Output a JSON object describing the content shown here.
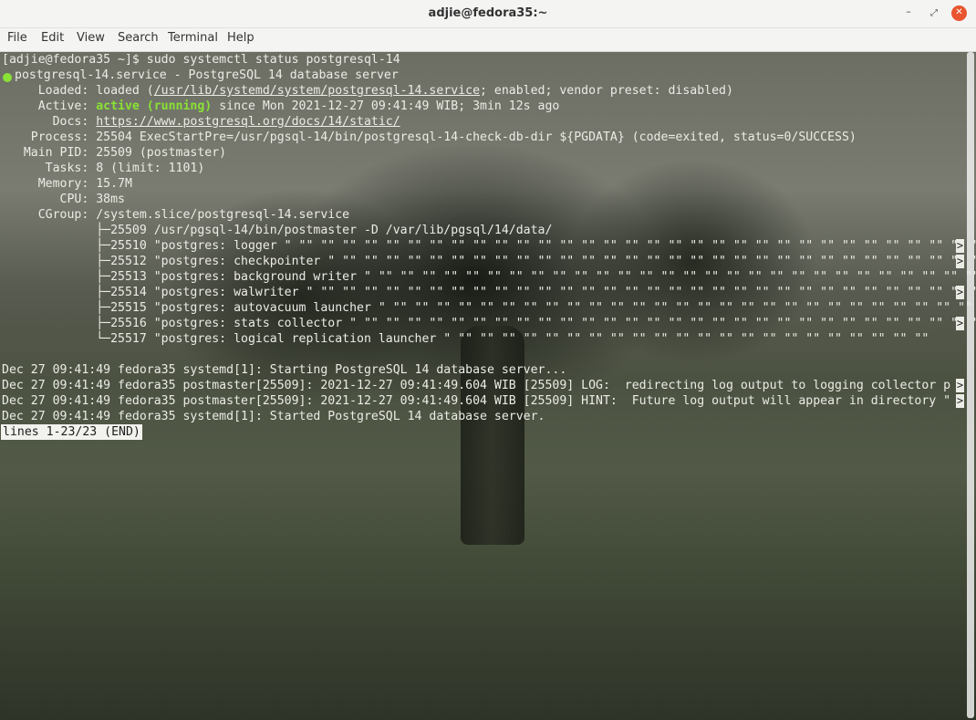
{
  "window": {
    "title": "adjie@fedora35:~",
    "min_glyph": "–",
    "max_glyph": "⤢",
    "close_glyph": "✕"
  },
  "menu": {
    "file": "File",
    "edit": "Edit",
    "view": "View",
    "search": "Search",
    "terminal": "Terminal",
    "help": "Help"
  },
  "terminal": {
    "prompt": "[adjie@fedora35 ~]$ sudo systemctl status postgresql-14",
    "unit_line": "postgresql-14.service - PostgreSQL 14 database server",
    "loaded_prefix": "     Loaded: loaded (",
    "loaded_path": "/usr/lib/systemd/system/postgresql-14.service",
    "loaded_suffix": "; enabled; vendor preset: disabled)",
    "active_prefix": "     Active: ",
    "active_state": "active (running)",
    "active_suffix": " since Mon 2021-12-27 09:41:49 WIB; 3min 12s ago",
    "docs_prefix": "       Docs: ",
    "docs_url": "https://www.postgresql.org/docs/14/static/",
    "process": "    Process: 25504 ExecStartPre=/usr/pgsql-14/bin/postgresql-14-check-db-dir ${PGDATA} (code=exited, status=0/SUCCESS)",
    "main_pid": "   Main PID: 25509 (postmaster)",
    "tasks": "      Tasks: 8 (limit: 1101)",
    "memory": "     Memory: 15.7M",
    "cpu": "        CPU: 38ms",
    "cgroup": "     CGroup: /system.slice/postgresql-14.service",
    "tree": [
      "             ├─25509 /usr/pgsql-14/bin/postmaster -D /var/lib/pgsql/14/data/",
      "             ├─25510 \"postgres: logger \" \"\" \"\" \"\" \"\" \"\" \"\" \"\" \"\" \"\" \"\" \"\" \"\" \"\" \"\" \"\" \"\" \"\" \"\" \"\" \"\" \"\" \"\" \"\" \"\" \"\" \"\" \"\" \"\" \"\" \"\" \"\" \"\" \"\"",
      "             ├─25512 \"postgres: checkpointer \" \"\" \"\" \"\" \"\" \"\" \"\" \"\" \"\" \"\" \"\" \"\" \"\" \"\" \"\" \"\" \"\" \"\" \"\" \"\" \"\" \"\" \"\" \"\" \"\" \"\" \"\" \"\" \"\" \"\" \"\" \"\"",
      "             ├─25513 \"postgres: background writer \" \"\" \"\" \"\" \"\" \"\" \"\" \"\" \"\" \"\" \"\" \"\" \"\" \"\" \"\" \"\" \"\" \"\" \"\" \"\" \"\" \"\" \"\" \"\" \"\" \"\" \"\" \"\" \"\" \"\"",
      "             ├─25514 \"postgres: walwriter \" \"\" \"\" \"\" \"\" \"\" \"\" \"\" \"\" \"\" \"\" \"\" \"\" \"\" \"\" \"\" \"\" \"\" \"\" \"\" \"\" \"\" \"\" \"\" \"\" \"\" \"\" \"\" \"\" \"\" \"\" \"\" \"\"",
      "             ├─25515 \"postgres: autovacuum launcher \" \"\" \"\" \"\" \"\" \"\" \"\" \"\" \"\" \"\" \"\" \"\" \"\" \"\" \"\" \"\" \"\" \"\" \"\" \"\" \"\" \"\" \"\" \"\" \"\" \"\" \"\" \"\" \"\"",
      "             ├─25516 \"postgres: stats collector \" \"\" \"\" \"\" \"\" \"\" \"\" \"\" \"\" \"\" \"\" \"\" \"\" \"\" \"\" \"\" \"\" \"\" \"\" \"\" \"\" \"\" \"\" \"\" \"\" \"\" \"\" \"\" \"\" \"\" \"\"",
      "             └─25517 \"postgres: logical replication launcher \" \"\" \"\" \"\" \"\" \"\" \"\" \"\" \"\" \"\" \"\" \"\" \"\" \"\" \"\" \"\" \"\" \"\" \"\" \"\" \"\" \"\" \"\""
    ],
    "log": [
      "Dec 27 09:41:49 fedora35 systemd[1]: Starting PostgreSQL 14 database server...",
      "Dec 27 09:41:49 fedora35 postmaster[25509]: 2021-12-27 09:41:49.604 WIB [25509] LOG:  redirecting log output to logging collector p",
      "Dec 27 09:41:49 fedora35 postmaster[25509]: 2021-12-27 09:41:49.604 WIB [25509] HINT:  Future log output will appear in directory \"",
      "Dec 27 09:41:49 fedora35 systemd[1]: Started PostgreSQL 14 database server."
    ],
    "truncation_marker": ">",
    "pager_status": "lines 1-23/23 (END)"
  }
}
